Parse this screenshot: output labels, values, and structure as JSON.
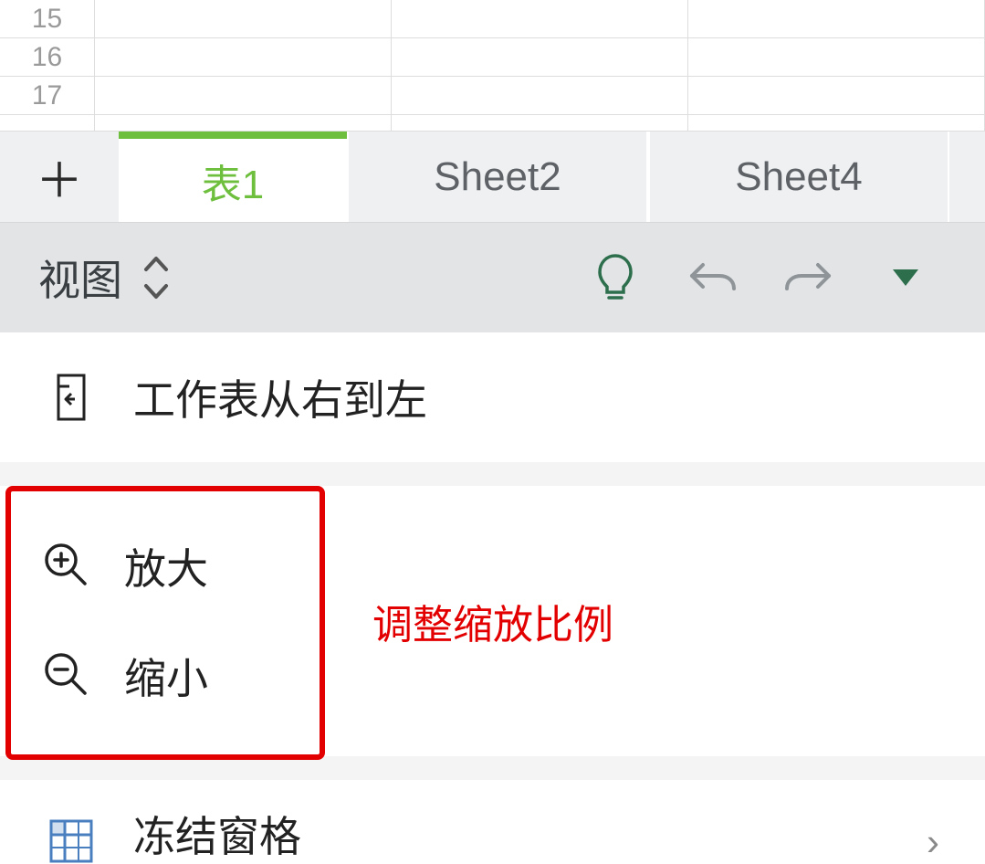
{
  "grid": {
    "visible_rows": [
      "15",
      "16",
      "17"
    ]
  },
  "tabs": {
    "items": [
      {
        "label": "表1",
        "active": true
      },
      {
        "label": "Sheet2",
        "active": false
      },
      {
        "label": "Sheet4",
        "active": false
      }
    ]
  },
  "toolbar": {
    "view_label": "视图"
  },
  "menu": {
    "rtl_label": "工作表从右到左",
    "zoom_in_label": "放大",
    "zoom_out_label": "缩小",
    "zoom_caption": "调整缩放比例",
    "freeze_label": "冻结窗格"
  },
  "colors": {
    "accent": "#6ebf3d",
    "highlight": "#e30000"
  }
}
